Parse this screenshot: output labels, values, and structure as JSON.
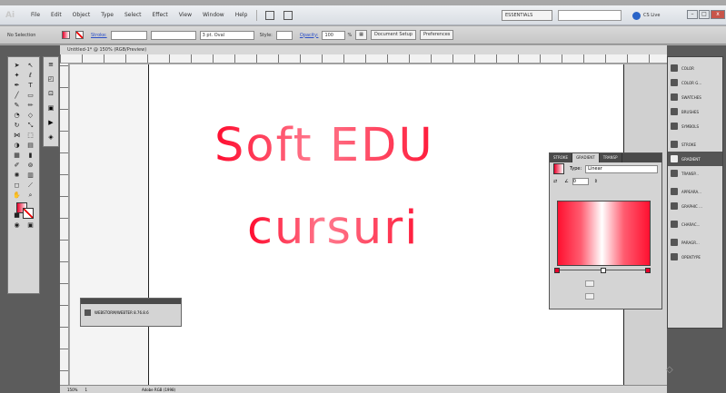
{
  "menubar": {
    "app_logo": "Ai",
    "items": [
      "File",
      "Edit",
      "Object",
      "Type",
      "Select",
      "Effect",
      "View",
      "Window",
      "Help"
    ],
    "workspace": "ESSENTIALS",
    "cs_live": "CS Live",
    "window_controls": [
      "–",
      "□",
      "x"
    ]
  },
  "controlbar": {
    "selection_label": "No Selection",
    "stroke_label": "Stroke:",
    "brush_value": "3 pt. Oval",
    "style_label": "Style:",
    "opacity_label": "Opacity:",
    "opacity_value": "100",
    "percent": "%",
    "document_setup": "Document Setup",
    "preferences": "Preferences"
  },
  "document": {
    "tab_title": "Untitled-1* @ 150% (RGB/Preview)"
  },
  "canvas": {
    "line1": "Soft EDU",
    "line2": "cursuri"
  },
  "mini_panel": {
    "label": "WEBSTORM/WEBTER 8.76.8.6"
  },
  "gradient_panel": {
    "tabs": [
      "STROKE",
      "GRADIENT",
      "TRANSP"
    ],
    "type_label": "Type:",
    "type_value": "Linear",
    "angle_value": "0",
    "field1": "",
    "field2": ""
  },
  "dock": {
    "items": [
      {
        "label": "COLOR",
        "icon": "color-icon"
      },
      {
        "label": "COLOR G...",
        "icon": "color-guide-icon"
      },
      {
        "label": "SWATCHES",
        "icon": "swatches-icon"
      },
      {
        "label": "BRUSHES",
        "icon": "brushes-icon"
      },
      {
        "label": "SYMBOLS",
        "icon": "symbols-icon"
      },
      {
        "label": "STROKE",
        "icon": "stroke-icon"
      },
      {
        "label": "GRADIENT",
        "icon": "gradient-icon"
      },
      {
        "label": "TRANSP...",
        "icon": "transparency-icon"
      },
      {
        "label": "APPEARA...",
        "icon": "appearance-icon"
      },
      {
        "label": "GRAPHIC ...",
        "icon": "graphic-styles-icon"
      },
      {
        "label": "CHARAC...",
        "icon": "character-icon"
      },
      {
        "label": "PARAGR...",
        "icon": "paragraph-icon"
      },
      {
        "label": "OPENTYPE",
        "icon": "opentype-icon"
      }
    ]
  },
  "statusbar": {
    "zoom": "150%",
    "page": "1",
    "status": "Adobe RGB (1998)"
  },
  "colors": {
    "accent": "#e8002a"
  }
}
